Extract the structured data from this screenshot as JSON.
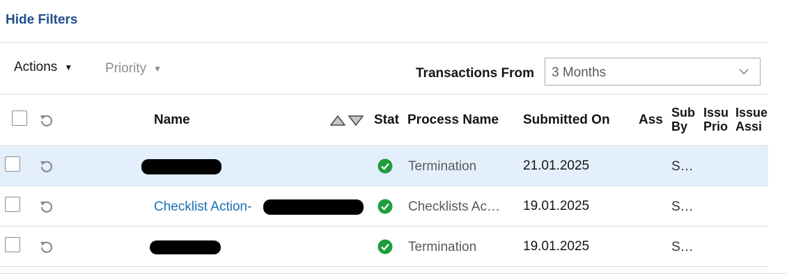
{
  "filters": {
    "hide_label": "Hide Filters"
  },
  "toolbar": {
    "actions_label": "Actions",
    "priority_label": "Priority",
    "transactions_from_label": "Transactions From",
    "transactions_from_value": "3 Months"
  },
  "table": {
    "headers": {
      "name": "Name",
      "status": "Stat",
      "process_name": "Process Name",
      "submitted_on": "Submitted On",
      "assigned": "Ass",
      "submitted_by": "Sub\nBy",
      "issue_priority": "Issu\nPrio",
      "issue_assigned": "Issue\nAssi"
    },
    "rows": [
      {
        "name": "",
        "process_name": "Termination",
        "submitted_on": "21.01.2025",
        "submitted_by": "S…",
        "selected": true
      },
      {
        "name": "Checklist Action-",
        "process_name": "Checklists Ac…",
        "submitted_on": "19.01.2025",
        "submitted_by": "S…",
        "selected": false
      },
      {
        "name": "",
        "process_name": "Termination",
        "submitted_on": "19.01.2025",
        "submitted_by": "S…",
        "selected": false
      }
    ]
  },
  "colors": {
    "accent": "#1f4e8c",
    "link": "#1a6fb3",
    "success": "#1e9e3d",
    "selected_row": "#e3f0fc"
  }
}
